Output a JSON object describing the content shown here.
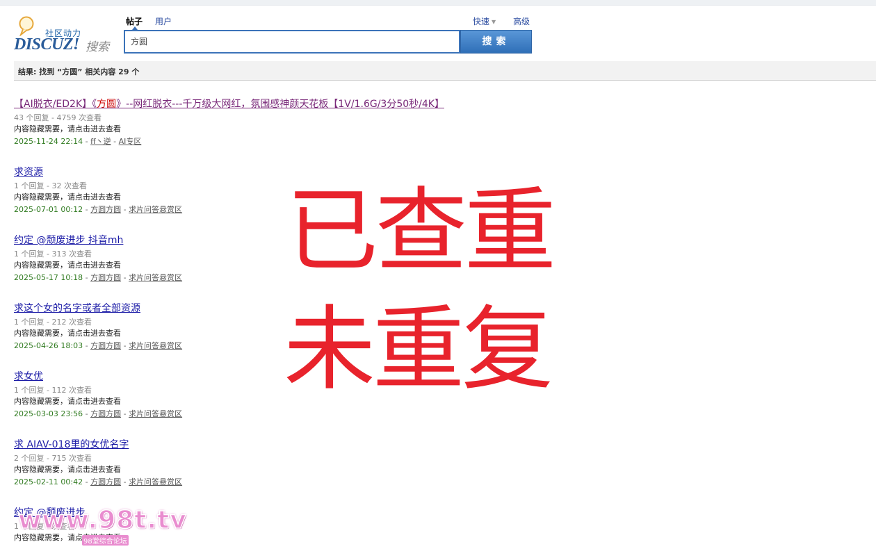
{
  "logo": {
    "cn": "社区动力",
    "brand": "DISCUZ!",
    "search_word": "搜索"
  },
  "search": {
    "types": [
      "帖子",
      "用户"
    ],
    "active_type": "帖子",
    "quick": "快速",
    "advanced": "高级",
    "query": "方圆",
    "button": "搜索"
  },
  "summary": "结果: 找到 “方圆” 相关内容 29 个",
  "results": [
    {
      "pre": "【AI脱衣/ED2K】《",
      "hl": "方圆",
      "post": "》--网红脱衣---千万级大网红，氛围感神颜天花板【1V/1.6G/3分50秒/4K】",
      "stats": "43 个回复 - 4759 次查看",
      "hidden": "内容隐藏需要，请点击进去查看",
      "date": "2025-11-24 22:14",
      "author": "ff丶逆",
      "forum": "AI专区"
    },
    {
      "pre": "求资源",
      "hl": "",
      "post": "",
      "stats": "1 个回复 - 32 次查看",
      "hidden": "内容隐藏需要，请点击进去查看",
      "date": "2025-07-01 00:12",
      "author": "方圆方圆",
      "forum": "求片问答悬赏区"
    },
    {
      "pre": "约定 @颓废进步 抖音mh",
      "hl": "",
      "post": "",
      "stats": "1 个回复 - 313 次查看",
      "hidden": "内容隐藏需要，请点击进去查看",
      "date": "2025-05-17 10:18",
      "author": "方圆方圆",
      "forum": "求片问答悬赏区"
    },
    {
      "pre": "求这个女的名字或者全部资源",
      "hl": "",
      "post": "",
      "stats": "1 个回复 - 212 次查看",
      "hidden": "内容隐藏需要，请点击进去查看",
      "date": "2025-04-26 18:03",
      "author": "方圆方圆",
      "forum": "求片问答悬赏区"
    },
    {
      "pre": "求女优",
      "hl": "",
      "post": "",
      "stats": "1 个回复 - 112 次查看",
      "hidden": "内容隐藏需要，请点击进去查看",
      "date": "2025-03-03 23:56",
      "author": "方圆方圆",
      "forum": "求片问答悬赏区"
    },
    {
      "pre": "求 AIAV-018里的女优名字",
      "hl": "",
      "post": "",
      "stats": "2 个回复 - 715 次查看",
      "hidden": "内容隐藏需要，请点击进去查看",
      "date": "2025-02-11 00:42",
      "author": "方圆方圆",
      "forum": "求片问答悬赏区"
    },
    {
      "pre": "约定 @颓废进步",
      "hl": "",
      "post": "",
      "stats": "1 个回复 - 次查看",
      "hidden": "内容隐藏需要，请点击进去查看",
      "date": "",
      "author": "",
      "forum": ""
    }
  ],
  "stamps": {
    "line1": "已查重",
    "line2": "未重复"
  },
  "watermark": {
    "url": "www.98t.tv",
    "sub": "98堂综合论坛"
  },
  "colors": {
    "stamp": "#e8232c",
    "link": "#1a1aa6",
    "visited": "#7a2a7a",
    "date": "#2f7a1f",
    "highlight": "#cc0000",
    "button": "#2f6fb8"
  }
}
